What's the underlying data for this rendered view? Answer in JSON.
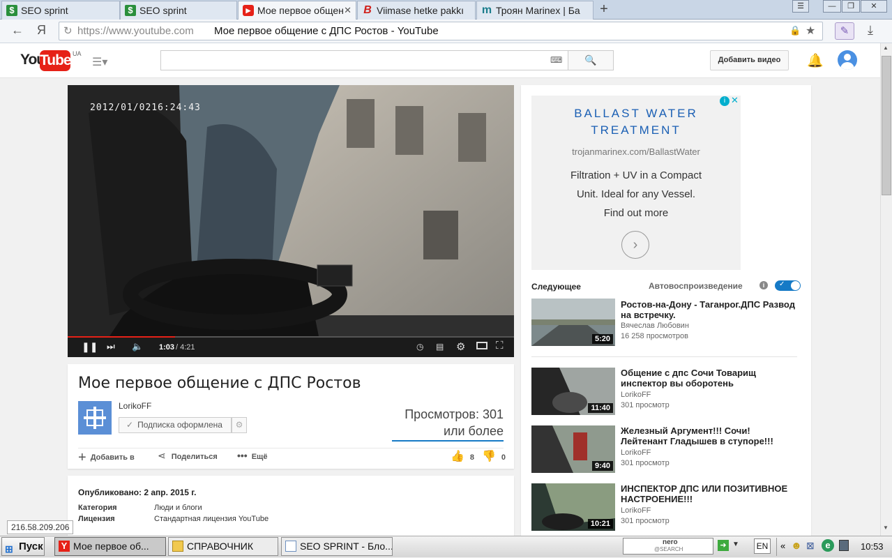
{
  "browser": {
    "tabs": [
      {
        "label": "SEO sprint"
      },
      {
        "label": "SEO sprint"
      },
      {
        "label": "Мое первое общен"
      },
      {
        "label": "Viimase hetke pakkı"
      },
      {
        "label": "Троян Marinex | Ба"
      }
    ],
    "nav": {
      "yandex": "Я",
      "url_host": "https://www.youtube.com",
      "url_title": "Мое первое общение с ДПС Ростов - YouTube"
    }
  },
  "youtube": {
    "logo_you": "You",
    "logo_tube": "Tube",
    "region": "UA",
    "upload_label": "Добавить видео"
  },
  "player": {
    "timestamp": "2012/01/0216:24:43",
    "time_current": "1:03",
    "time_total": "/ 4:21",
    "progress": 0.24
  },
  "video": {
    "title": "Мое первое общение с ДПС Ростов",
    "channel": "LorikoFF",
    "subscribe_label": "Подписка оформлена",
    "views_line1": "Просмотров: 301",
    "views_line2": "или более",
    "add_to": "Добавить в",
    "share": "Поделиться",
    "more": "Ещё",
    "likes": "8",
    "dislikes": "0"
  },
  "description": {
    "published": "Опубликовано: 2 апр. 2015 г.",
    "category_label": "Категория",
    "category_value": "Люди и блоги",
    "license_label": "Лицензия",
    "license_value": "Стандартная лицензия YouTube"
  },
  "ad": {
    "headline1": "BALLAST WATER",
    "headline2": "TREATMENT",
    "url": "trojanmarinex.com/BallastWater",
    "line1": "Filtration + UV in a Compact",
    "line2": "Unit. Ideal for any Vessel.",
    "line3": "Find out more"
  },
  "sidebar": {
    "next_label": "Следующее",
    "autoplay_label": "Автовоспроизведение",
    "recs": [
      {
        "title1": "Ростов-на-Дону - Таганрог.ДПС Развод",
        "title2": "на встречку.",
        "channel": "Вячеслав Любовин",
        "views": "16 258 просмотров",
        "duration": "5:20"
      },
      {
        "title1": "Общение с дпс Сочи Товарищ",
        "title2": "инспектор вы оборотень",
        "channel": "LorikoFF",
        "views": "301 просмотр",
        "duration": "11:40"
      },
      {
        "title1": "Железный Аргумент!!! Сочи!",
        "title2": "Лейтенант Гладышев в ступоре!!!",
        "channel": "LorikoFF",
        "views": "301 просмотр",
        "duration": "9:40"
      },
      {
        "title1": "ИНСПЕКТОР ДПС ИЛИ ПОЗИТИВНОЕ",
        "title2": "НАСТРОЕНИЕ!!!",
        "channel": "LorikoFF",
        "views": "301 просмотр",
        "duration": "10:21"
      }
    ]
  },
  "status_ip": "216.58.209.206",
  "taskbar": {
    "start": "Пуск",
    "items": [
      {
        "label": "Мое первое об..."
      },
      {
        "label": "СПРАВОЧНИК"
      },
      {
        "label": "SEO SPRINT - Бло..."
      }
    ],
    "nero": "nero",
    "nero_sub": "@SEARCH",
    "lang": "EN",
    "clock": "10:53"
  },
  "colors": {
    "yt_red": "#e62117",
    "yt_blue": "#167ac6",
    "ad_blue": "#1a5fb4"
  }
}
